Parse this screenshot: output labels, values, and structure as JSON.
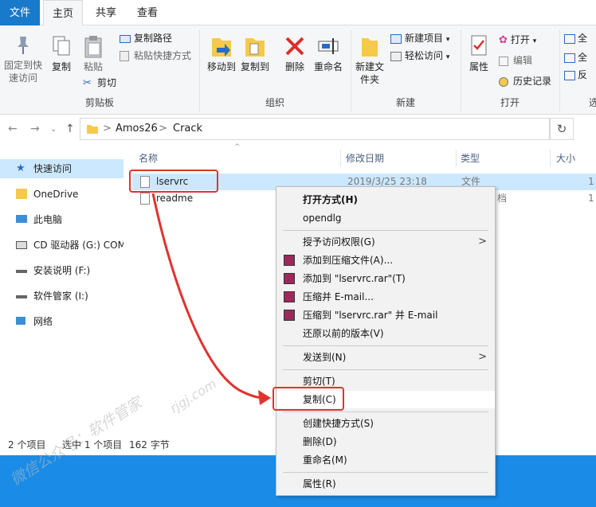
{
  "tabs": {
    "file": "文件",
    "home": "主页",
    "share": "共享",
    "view": "查看"
  },
  "ribbon": {
    "pin": "固定到快速访问",
    "copy": "复制",
    "paste": "粘贴",
    "copy_path": "复制路径",
    "paste_shortcut": "粘贴快捷方式",
    "cut": "剪切",
    "move_to": "移动到",
    "copy_to": "复制到",
    "delete": "删除",
    "rename": "重命名",
    "new_folder": "新建文件夹",
    "new_item": "新建项目",
    "easy_access": "轻松访问",
    "properties": "属性",
    "open": "打开",
    "edit": "编辑",
    "history": "历史记录",
    "select_all": "全",
    "select_none": "全",
    "invert": "反",
    "select_group": "选",
    "group_clipboard": "剪贴板",
    "group_organize": "组织",
    "group_new": "新建",
    "group_open": "打开"
  },
  "address": {
    "crumb1": "Amos26",
    "crumb2": "Crack",
    "sep": ">"
  },
  "sidebar": {
    "items": [
      "快速访问",
      "OneDrive",
      "此电脑",
      "CD 驱动器 (G:) COM",
      "安装说明 (F:)",
      "软件管家 (I:)",
      "网络"
    ]
  },
  "columns": {
    "name": "名称",
    "date": "修改日期",
    "type": "类型",
    "size": "大小"
  },
  "files": [
    {
      "name": "lservrc",
      "date": "2019/3/25 23:18",
      "type": "文件",
      "size": "1"
    },
    {
      "name": "readme",
      "date": "",
      "type": "档",
      "size": "1"
    }
  ],
  "status": {
    "count": "2 个项目",
    "selected": "选中 1 个项目",
    "size": "162 字节"
  },
  "context_menu": {
    "open_with": "打开方式(H)",
    "opendlg": "opendlg",
    "grant": "授予访问权限(G)",
    "add_archive": "添加到压缩文件(A)...",
    "add_rar": "添加到 \"lservrc.rar\"(T)",
    "compress_email": "压缩并 E-mail...",
    "compress_rar_email": "压缩到 \"lservrc.rar\" 并 E-mail",
    "restore": "还原以前的版本(V)",
    "send_to": "发送到(N)",
    "cut": "剪切(T)",
    "copy": "复制(C)",
    "create_shortcut": "创建快捷方式(S)",
    "delete": "删除(D)",
    "rename": "重命名(M)",
    "properties": "属性(R)"
  },
  "watermark": {
    "text1": "微信公众号：软件管家",
    "text2": "rjgj.com"
  },
  "colors": {
    "accent": "#1979ca",
    "selection": "#cce8ff",
    "highlight": "#e0332f",
    "taskbar": "#1a8ce8"
  }
}
